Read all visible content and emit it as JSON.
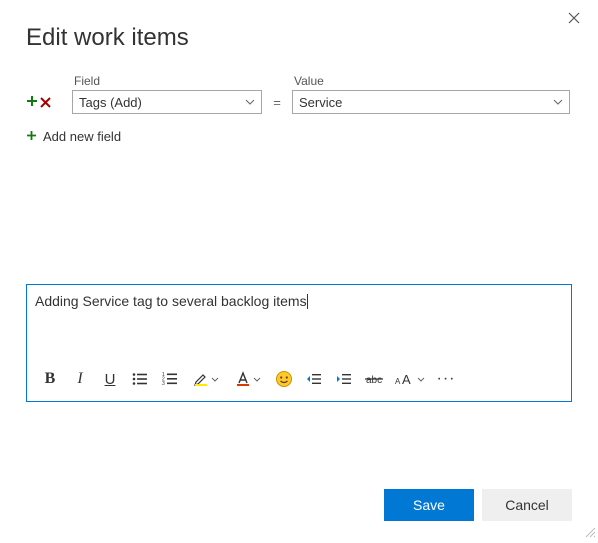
{
  "dialog": {
    "title": "Edit work items"
  },
  "fieldRow": {
    "fieldLabel": "Field",
    "fieldValue": "Tags (Add)",
    "equals": "=",
    "valueLabel": "Value",
    "valueValue": "Service"
  },
  "addNew": {
    "label": "Add new field"
  },
  "editor": {
    "content": "Adding Service tag to several backlog items"
  },
  "toolbar": {
    "bold": "B",
    "italic": "I",
    "underline": "U",
    "more": "···"
  },
  "footer": {
    "save": "Save",
    "cancel": "Cancel"
  }
}
